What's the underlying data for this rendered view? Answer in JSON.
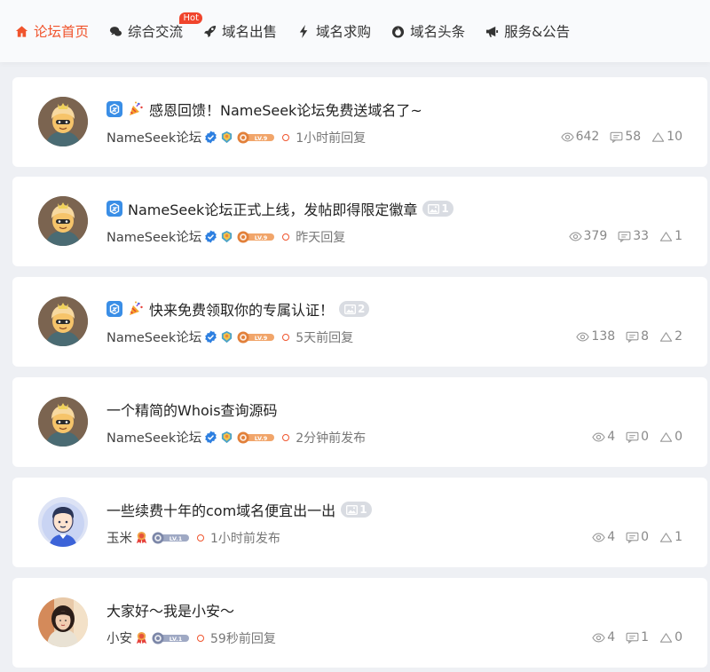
{
  "nav": {
    "items": [
      {
        "label": "论坛首页",
        "icon": "home-icon",
        "active": true
      },
      {
        "label": "综合交流",
        "icon": "chat-icon",
        "badge": "Hot"
      },
      {
        "label": "域名出售",
        "icon": "rocket-icon"
      },
      {
        "label": "域名求购",
        "icon": "bolt-icon"
      },
      {
        "label": "域名头条",
        "icon": "fire-icon"
      },
      {
        "label": "服务&公告",
        "icon": "megaphone-icon"
      }
    ]
  },
  "colors": {
    "accent": "#f0542d",
    "hot": "#f0442c",
    "pin": "#3a8ee6"
  },
  "posts": [
    {
      "title": "感恩回馈！NameSeek论坛免费送域名了~",
      "pinned": true,
      "party": true,
      "images": null,
      "author": "NameSeek论坛",
      "verified": true,
      "level": "LV.9",
      "time": "1小时前回复",
      "views": "642",
      "comments": "58",
      "likes": "10",
      "avatar": "cartoon-avatar"
    },
    {
      "title": "NameSeek论坛正式上线，发帖即得限定徽章",
      "pinned": true,
      "party": false,
      "images": "1",
      "author": "NameSeek论坛",
      "verified": true,
      "level": "LV.9",
      "time": "昨天回复",
      "views": "379",
      "comments": "33",
      "likes": "1",
      "avatar": "cartoon-avatar"
    },
    {
      "title": "快来免费领取你的专属认证！",
      "pinned": true,
      "party": true,
      "images": "2",
      "author": "NameSeek论坛",
      "verified": true,
      "level": "LV.9",
      "time": "5天前回复",
      "views": "138",
      "comments": "8",
      "likes": "2",
      "avatar": "cartoon-avatar"
    },
    {
      "title": "一个精简的Whois查询源码",
      "pinned": false,
      "party": false,
      "images": null,
      "author": "NameSeek论坛",
      "verified": true,
      "level": "LV.9",
      "time": "2分钟前发布",
      "views": "4",
      "comments": "0",
      "likes": "0",
      "avatar": "cartoon-avatar"
    },
    {
      "title": "一些续费十年的com域名便宜出一出",
      "pinned": false,
      "party": false,
      "images": "1",
      "author": "玉米",
      "verified": false,
      "level": "LV.1",
      "time": "1小时前发布",
      "views": "4",
      "comments": "0",
      "likes": "1",
      "avatar": "boy-avatar"
    },
    {
      "title": "大家好～我是小安～",
      "pinned": false,
      "party": false,
      "images": null,
      "author": "小安",
      "verified": false,
      "level": "LV.1",
      "time": "59秒前回复",
      "views": "4",
      "comments": "1",
      "likes": "0",
      "avatar": "photo-avatar"
    }
  ]
}
